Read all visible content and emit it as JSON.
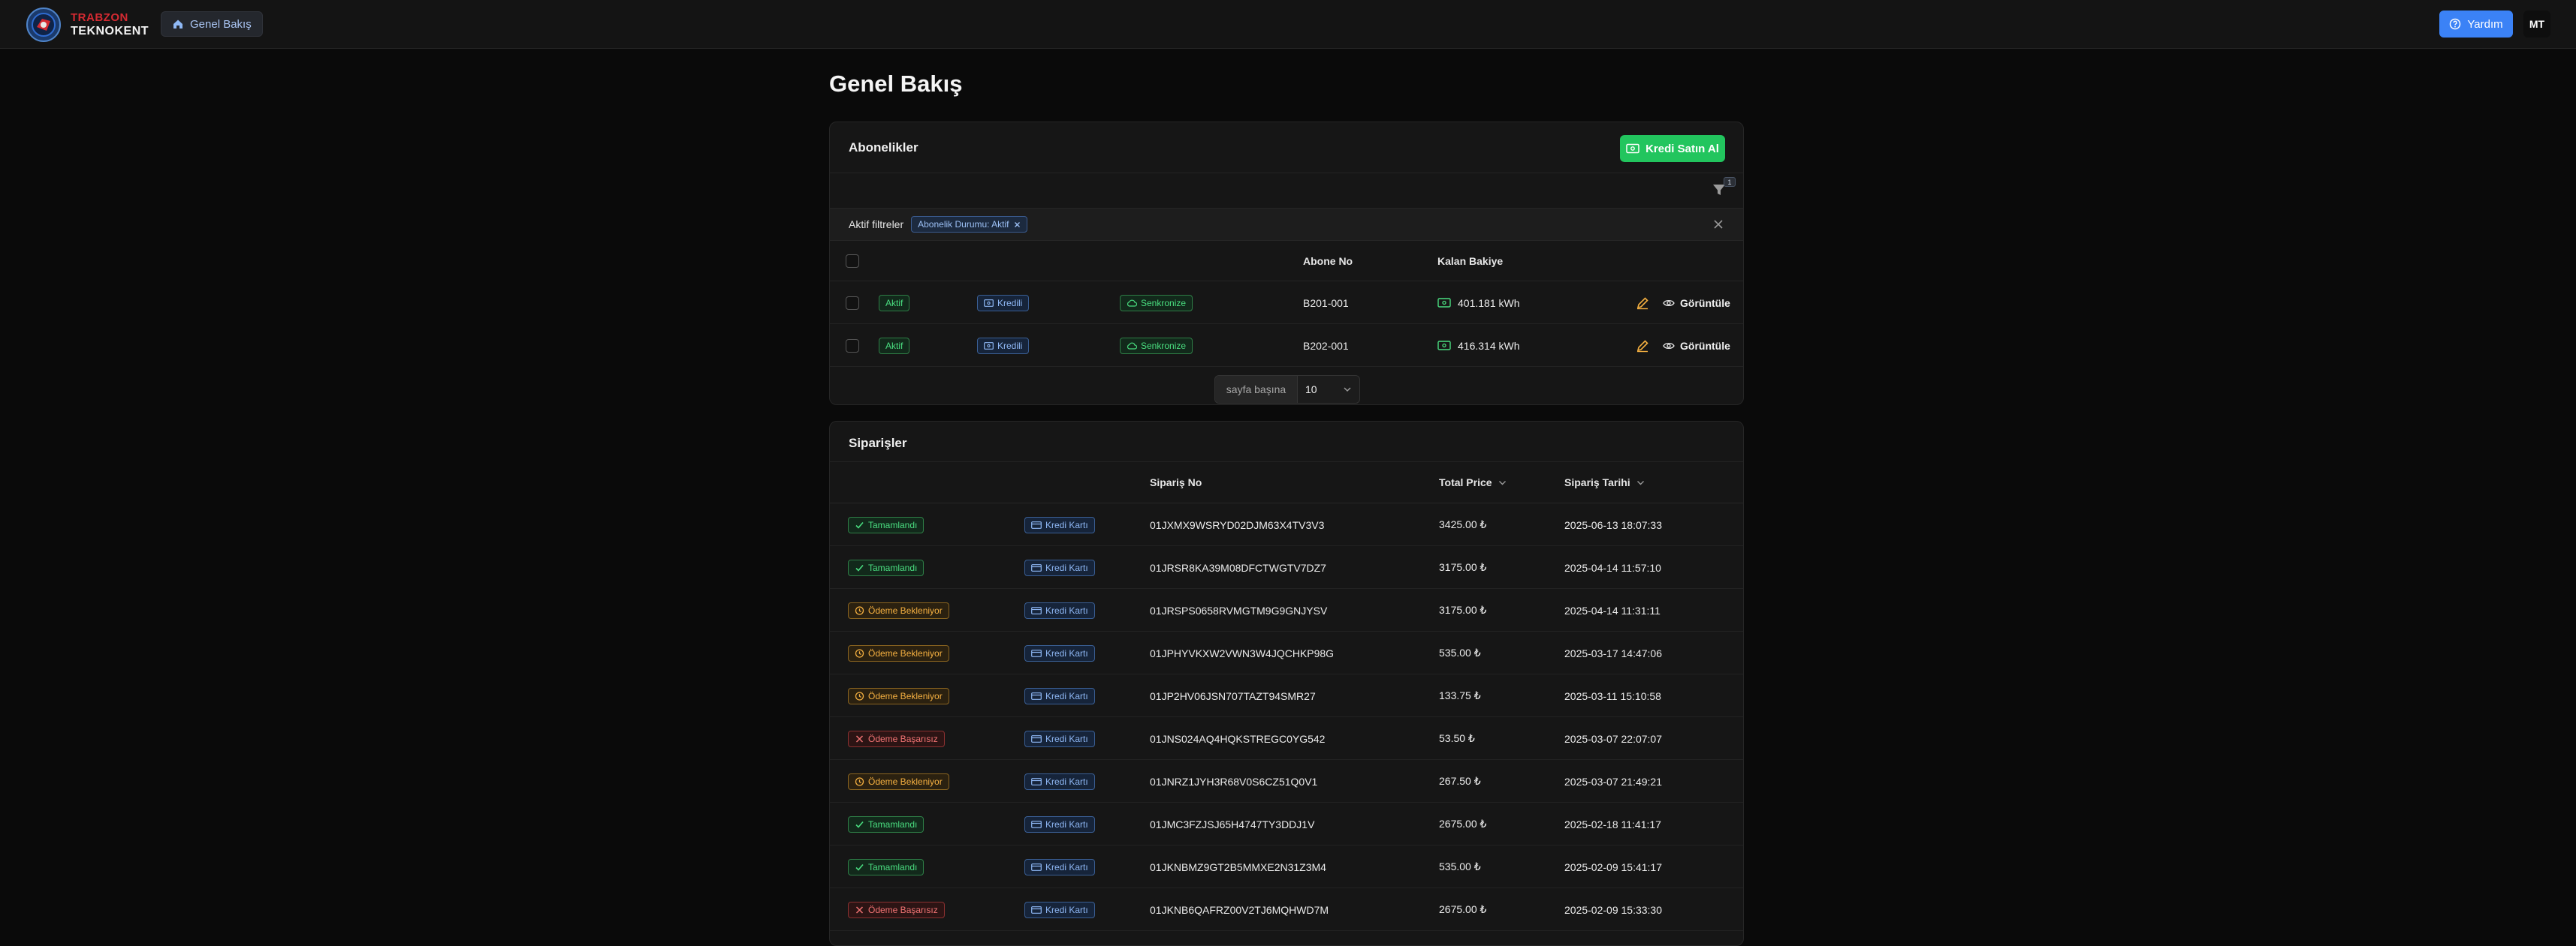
{
  "brand": {
    "line1": "TRABZON",
    "line2": "TEKNOKENT"
  },
  "nav": {
    "breadcrumb": "Genel Bakış"
  },
  "header": {
    "help_label": "Yardım",
    "avatar_initials": "MT"
  },
  "page": {
    "title": "Genel Bakış"
  },
  "subscriptions": {
    "title": "Abonelikler",
    "buy_button": "Kredi Satın Al",
    "filter_count": "1",
    "active_filters_label": "Aktif filtreler",
    "filter_chip": "Abonelik Durumu: Aktif",
    "columns": {
      "subscriber_no": "Abone No",
      "balance": "Kalan Bakiye"
    },
    "rows": [
      {
        "status": "Aktif",
        "type": "Kredili",
        "sync": "Senkronize",
        "subscriber_no": "B201-001",
        "balance": "401.181 kWh",
        "view": "Görüntüle"
      },
      {
        "status": "Aktif",
        "type": "Kredili",
        "sync": "Senkronize",
        "subscriber_no": "B202-001",
        "balance": "416.314 kWh",
        "view": "Görüntüle"
      }
    ],
    "pagination": {
      "per_page_label": "sayfa başına",
      "per_page_value": "10"
    }
  },
  "orders": {
    "title": "Siparişler",
    "columns": {
      "order_no": "Sipariş No",
      "total_price": "Total Price",
      "order_date": "Sipariş Tarihi"
    },
    "rows": [
      {
        "status": "Tamamlandı",
        "status_kind": "success",
        "payment": "Kredi Kartı",
        "order_no": "01JXMX9WSRYD02DJM63X4TV3V3",
        "price": "3425.00 ₺",
        "date": "2025-06-13 18:07:33"
      },
      {
        "status": "Tamamlandı",
        "status_kind": "success",
        "payment": "Kredi Kartı",
        "order_no": "01JRSR8KA39M08DFCTWGTV7DZ7",
        "price": "3175.00 ₺",
        "date": "2025-04-14 11:57:10"
      },
      {
        "status": "Ödeme Bekleniyor",
        "status_kind": "pending",
        "payment": "Kredi Kartı",
        "order_no": "01JRSPS0658RVMGTM9G9GNJYSV",
        "price": "3175.00 ₺",
        "date": "2025-04-14 11:31:11"
      },
      {
        "status": "Ödeme Bekleniyor",
        "status_kind": "pending",
        "payment": "Kredi Kartı",
        "order_no": "01JPHYVKXW2VWN3W4JQCHKP98G",
        "price": "535.00 ₺",
        "date": "2025-03-17 14:47:06"
      },
      {
        "status": "Ödeme Bekleniyor",
        "status_kind": "pending",
        "payment": "Kredi Kartı",
        "order_no": "01JP2HV06JSN707TAZT94SMR27",
        "price": "133.75 ₺",
        "date": "2025-03-11 15:10:58"
      },
      {
        "status": "Ödeme Başarısız",
        "status_kind": "failed",
        "payment": "Kredi Kartı",
        "order_no": "01JNS024AQ4HQKSTREGC0YG542",
        "price": "53.50 ₺",
        "date": "2025-03-07 22:07:07"
      },
      {
        "status": "Ödeme Bekleniyor",
        "status_kind": "pending",
        "payment": "Kredi Kartı",
        "order_no": "01JNRZ1JYH3R68V0S6CZ51Q0V1",
        "price": "267.50 ₺",
        "date": "2025-03-07 21:49:21"
      },
      {
        "status": "Tamamlandı",
        "status_kind": "success",
        "payment": "Kredi Kartı",
        "order_no": "01JMC3FZJSJ65H4747TY3DDJ1V",
        "price": "2675.00 ₺",
        "date": "2025-02-18 11:41:17"
      },
      {
        "status": "Tamamlandı",
        "status_kind": "success",
        "payment": "Kredi Kartı",
        "order_no": "01JKNBMZ9GT2B5MMXE2N31Z3M4",
        "price": "535.00 ₺",
        "date": "2025-02-09 15:41:17"
      },
      {
        "status": "Ödeme Başarısız",
        "status_kind": "failed",
        "payment": "Kredi Kartı",
        "order_no": "01JKNB6QAFRZ00V2TJ6MQHWD7M",
        "price": "2675.00 ₺",
        "date": "2025-02-09 15:33:30"
      }
    ]
  },
  "colors": {
    "accent_blue": "#3b82f6",
    "success_green": "#22c55e",
    "pending_orange": "#f5b041",
    "failed_red": "#f27474"
  },
  "icons": {
    "logo": "teknokent-logo-icon",
    "home": "home-icon",
    "help": "help-circle-icon",
    "filter": "filter-icon",
    "close": "close-icon",
    "sync": "cloud-icon",
    "credit": "credit-icon",
    "edit": "edit-icon",
    "view": "eye-icon",
    "check": "check-icon",
    "clock": "clock-icon",
    "failed": "x-icon",
    "card": "credit-card-icon",
    "sort": "chevron-down-icon"
  }
}
